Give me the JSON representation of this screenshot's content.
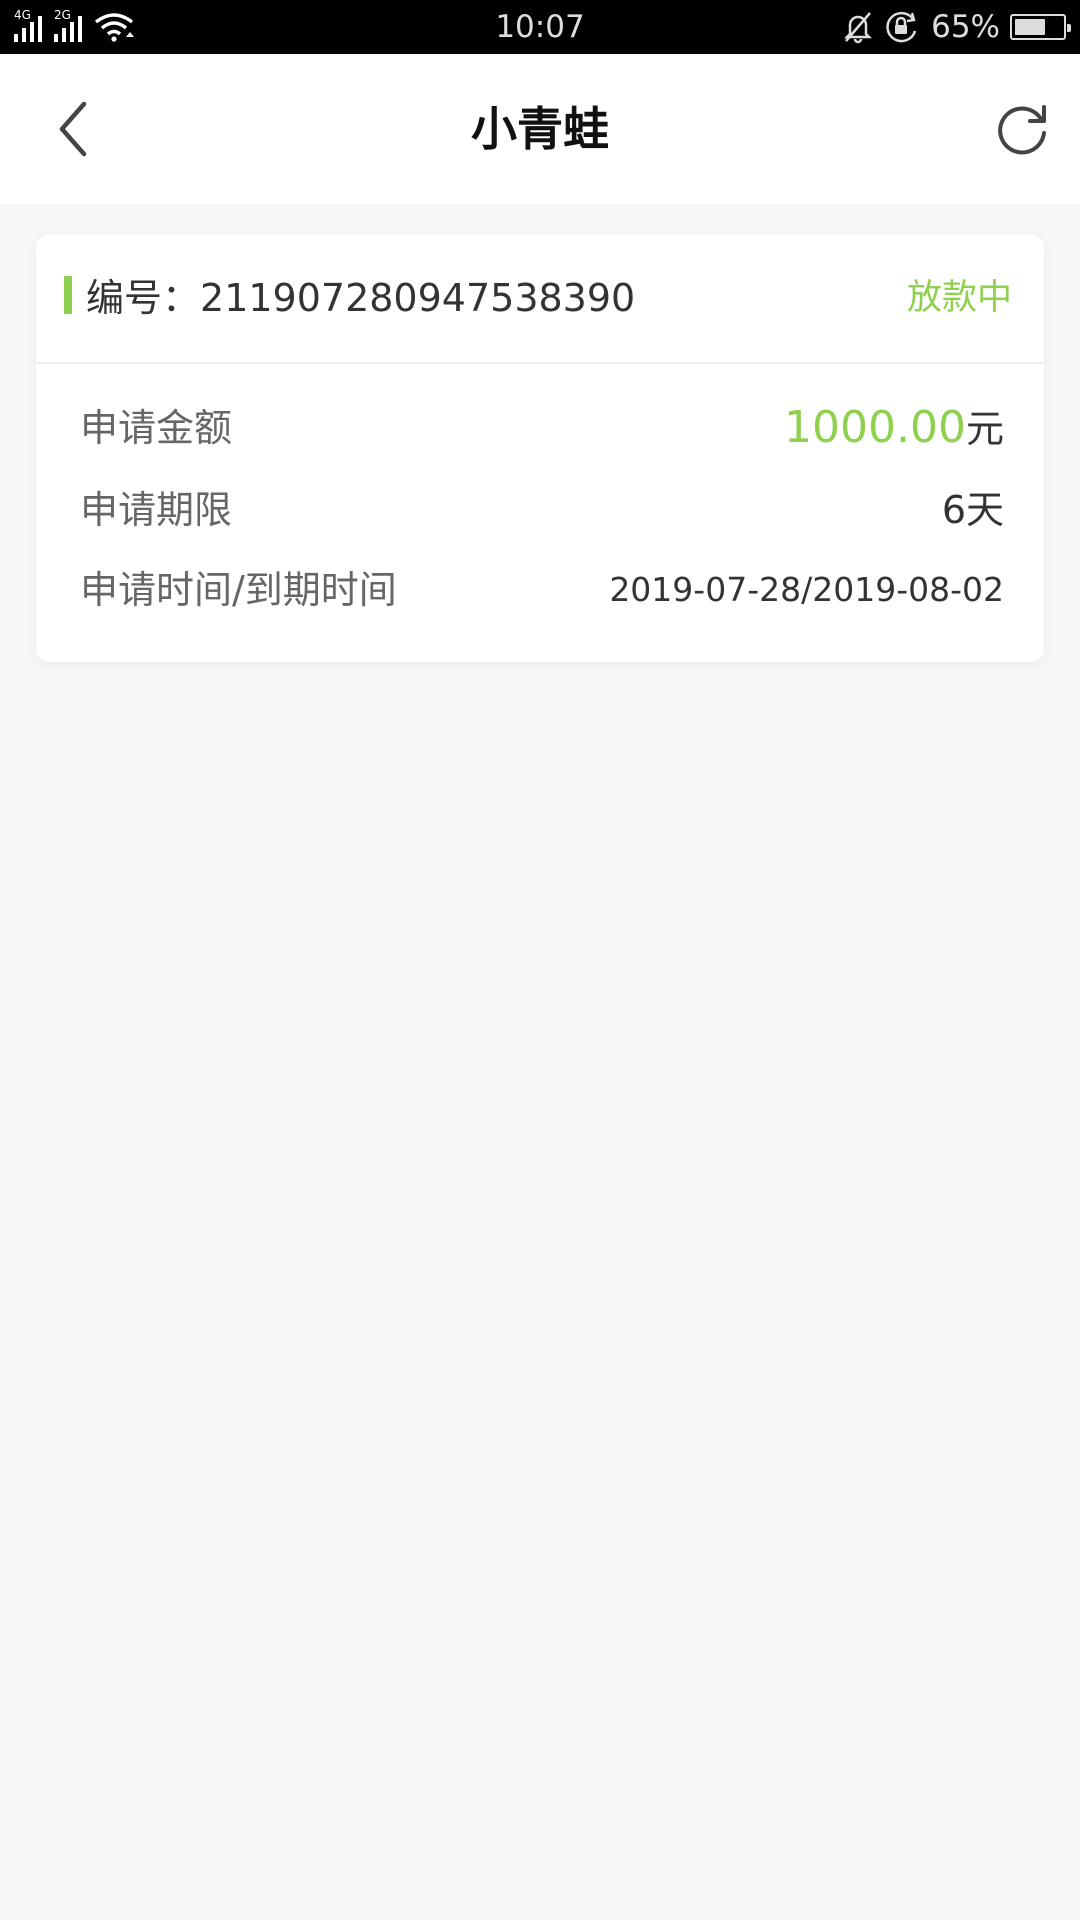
{
  "status_bar": {
    "network_1": "4G",
    "network_2": "2G",
    "time": "10:07",
    "battery_percent": "65%",
    "battery_level": 0.65,
    "icons": [
      "signal-icon",
      "signal-icon",
      "wifi-icon",
      "mute-icon",
      "rotation-lock-icon",
      "battery-icon"
    ]
  },
  "nav": {
    "title": "小青蛙",
    "back_icon": "chevron-left-icon",
    "refresh_icon": "refresh-icon"
  },
  "order": {
    "number_label": "编号：",
    "number": "211907280947538390",
    "status": "放款中",
    "rows": [
      {
        "label": "申请金额",
        "amount": "1000.00",
        "unit": "元"
      },
      {
        "label": "申请期限",
        "value": "6天"
      },
      {
        "label": "申请时间/到期时间",
        "value": "2019-07-28/2019-08-02"
      }
    ]
  },
  "colors": {
    "accent": "#8fd14f",
    "background": "#f7f7f7",
    "text_primary": "#333333",
    "text_label": "#666666"
  }
}
